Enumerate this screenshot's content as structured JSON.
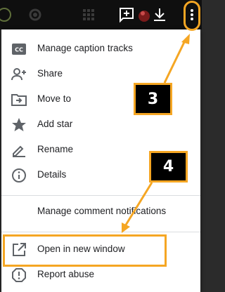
{
  "topbar": {
    "icons": [
      "help-icon",
      "settings-icon",
      "apps-grid-icon",
      "add-comment-icon",
      "avatar",
      "download-icon",
      "more-vertical-icon"
    ]
  },
  "menu": {
    "items": [
      {
        "label": "Manage caption tracks",
        "icon": "closed-caption-icon"
      },
      {
        "label": "Share",
        "icon": "person-add-icon"
      },
      {
        "label": "Move to",
        "icon": "folder-move-icon"
      },
      {
        "label": "Add star",
        "icon": "star-icon"
      },
      {
        "label": "Rename",
        "icon": "pencil-icon"
      },
      {
        "label": "Details",
        "icon": "info-icon"
      },
      {
        "label": "Manage comment notifications",
        "icon": ""
      },
      {
        "label": "Open in new window",
        "icon": "open-in-new-icon"
      },
      {
        "label": "Report abuse",
        "icon": "report-icon"
      }
    ]
  },
  "annotations": {
    "step3": "3",
    "step4": "4",
    "accent_color": "#f5a623"
  }
}
